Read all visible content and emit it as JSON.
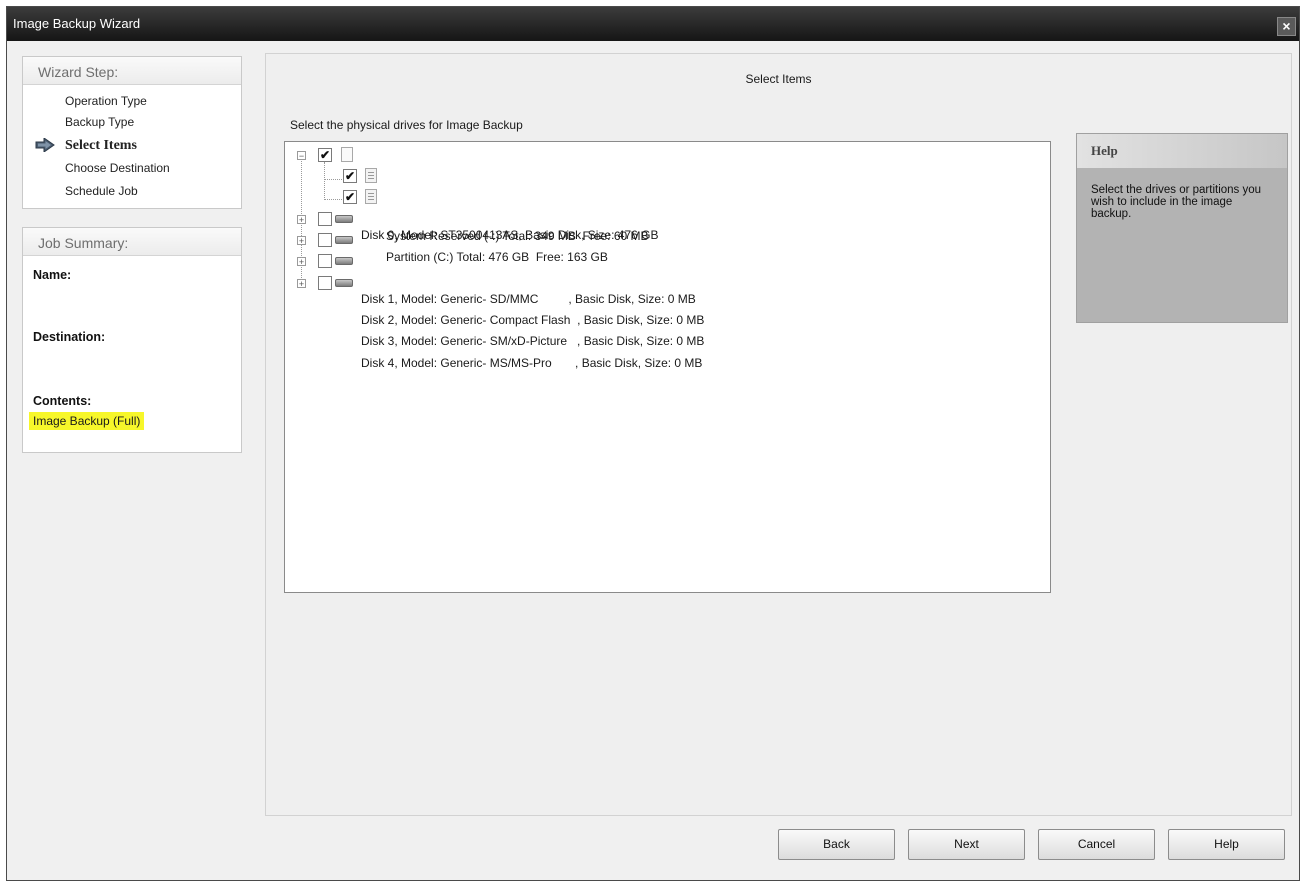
{
  "window": {
    "title": "Image Backup Wizard",
    "close_glyph": "×"
  },
  "wizard": {
    "heading": "Wizard Step:",
    "steps": [
      {
        "label": "Operation Type"
      },
      {
        "label": "Backup Type"
      },
      {
        "label": "Select Items",
        "active": true
      },
      {
        "label": "Choose Destination"
      },
      {
        "label": "Schedule Job"
      }
    ]
  },
  "summary": {
    "heading": "Job Summary:",
    "name_label": "Name:",
    "destination_label": "Destination:",
    "contents_label": "Contents:",
    "contents_value": "Image Backup (Full)"
  },
  "main": {
    "title": "Select Items",
    "instruction": "Select the physical drives for Image Backup"
  },
  "tree": {
    "disks": [
      {
        "expander": "−",
        "checked": true,
        "label": "Disk 0, Model: ST3500413AS, Basic Disk, Size: 476 GB",
        "partitions": [
          {
            "checked": true,
            "label": "System Reserved (-:) Total: 349 MB  Free: 60 MB"
          },
          {
            "checked": true,
            "label": "Partition (C:) Total: 476 GB  Free: 163 GB"
          }
        ]
      },
      {
        "expander": "+",
        "checked": false,
        "label": "Disk 1, Model: Generic- SD/MMC         , Basic Disk, Size: 0 MB"
      },
      {
        "expander": "+",
        "checked": false,
        "label": "Disk 2, Model: Generic- Compact Flash  , Basic Disk, Size: 0 MB"
      },
      {
        "expander": "+",
        "checked": false,
        "label": "Disk 3, Model: Generic- SM/xD-Picture   , Basic Disk, Size: 0 MB"
      },
      {
        "expander": "+",
        "checked": false,
        "label": "Disk 4, Model: Generic- MS/MS-Pro       , Basic Disk, Size: 0 MB"
      }
    ],
    "check_glyph": "✔"
  },
  "help": {
    "title": "Help",
    "text": "Select the drives or partitions you wish to include in the image backup."
  },
  "buttons": {
    "back": "Back",
    "next": "Next",
    "cancel": "Cancel",
    "help": "Help"
  },
  "colors": {
    "highlight": "#f7f72a",
    "titlebar": "#1e1e1e",
    "step_arrow": "#4a5b6e"
  }
}
